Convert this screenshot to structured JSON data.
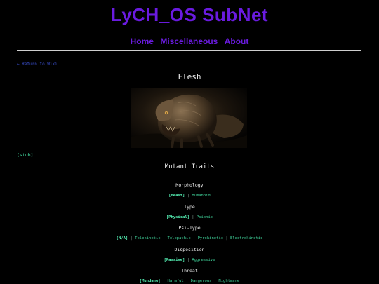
{
  "site": {
    "title": "LyCH_OS SubNet"
  },
  "nav": {
    "items": [
      "Home",
      "Miscellaneous",
      "About"
    ]
  },
  "back_link": "← Return to Wiki",
  "page": {
    "title": "Flesh",
    "stub": "[stub]",
    "section_title": "Mutant Traits"
  },
  "traits": [
    {
      "label": "Morphology",
      "options": [
        "[Beast]",
        "Humanoid"
      ]
    },
    {
      "label": "Type",
      "options": [
        "[Physical]",
        "Psionic"
      ]
    },
    {
      "label": "Psi-Type",
      "options": [
        "[N/A]",
        "Telekinetic",
        "Telepathic",
        "Pyrokinetic",
        "Electrokinetic"
      ]
    },
    {
      "label": "Disposition",
      "options": [
        "[Passive]",
        "Aggressive"
      ]
    },
    {
      "label": "Threat",
      "options": [
        "[Mundane]",
        "Harmful",
        "Dangerous",
        "Nightmare"
      ]
    }
  ],
  "colors": {
    "title": "#6a1be0",
    "link": "#3a4fcf",
    "accent": "#3fd39a",
    "selected": "#55f0b4",
    "background": "#000000"
  }
}
